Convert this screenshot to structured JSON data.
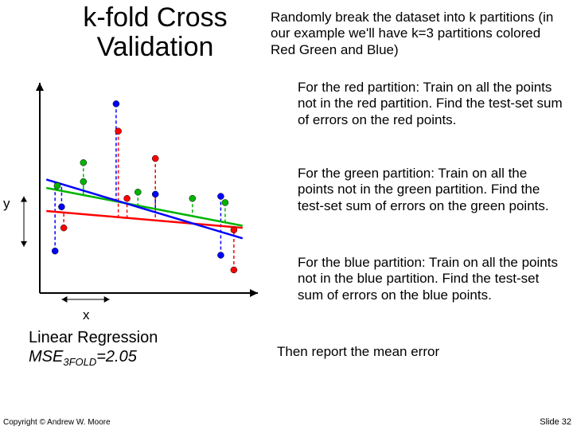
{
  "title": "k-fold Cross Validation",
  "intro": "Randomly break the dataset into k partitions (in our example we'll have k=3 partitions colored Red Green and Blue)",
  "paragraphs": {
    "red": "For the red partition: Train on all the points not in the red partition. Find the test-set sum of errors on the red points.",
    "green": "For the green partition: Train on all the points not in the green partition. Find the test-set sum of errors on the green points.",
    "blue": "For the blue partition: Train on all the points not in the blue partition. Find the test-set sum of errors on the blue points.",
    "mean": "Then report the mean error"
  },
  "axis": {
    "x": "x",
    "y": "y"
  },
  "caption": {
    "line1": "Linear Regression",
    "line2_prefix": "MSE",
    "line2_sub": "3FOLD",
    "line2_eq": "=2.05"
  },
  "footer": {
    "copyright": "Copyright © Andrew W. Moore",
    "slide": "Slide 32"
  },
  "colors": {
    "red": "#ff0000",
    "green": "#00b400",
    "blue": "#0000ff",
    "axis": "#000"
  },
  "chart_data": {
    "type": "scatter",
    "title": "k-fold Cross Validation",
    "xlabel": "x",
    "ylabel": "y",
    "xlim": [
      0,
      10
    ],
    "ylim": [
      0,
      10
    ],
    "series": [
      {
        "name": "red",
        "color": "#ff0000",
        "points": [
          [
            1.1,
            3.1
          ],
          [
            3.6,
            7.7
          ],
          [
            5.3,
            6.4
          ],
          [
            4.0,
            4.5
          ],
          [
            8.9,
            3.0
          ],
          [
            8.9,
            1.1
          ]
        ]
      },
      {
        "name": "green",
        "color": "#00b400",
        "points": [
          [
            0.8,
            5.1
          ],
          [
            2.0,
            5.3
          ],
          [
            2.0,
            6.2
          ],
          [
            4.5,
            4.8
          ],
          [
            7.0,
            4.5
          ],
          [
            8.5,
            4.3
          ]
        ]
      },
      {
        "name": "blue",
        "color": "#0000ff",
        "points": [
          [
            0.7,
            2.0
          ],
          [
            1.0,
            4.1
          ],
          [
            3.5,
            9.0
          ],
          [
            5.3,
            4.7
          ],
          [
            8.3,
            4.6
          ],
          [
            8.3,
            1.8
          ]
        ]
      }
    ],
    "lines": [
      {
        "name": "fit-on-not-red",
        "color": "#ff0000",
        "p1": [
          0.3,
          3.9
        ],
        "p2": [
          9.3,
          3.1
        ]
      },
      {
        "name": "fit-on-not-green",
        "color": "#00b400",
        "p1": [
          0.3,
          5.0
        ],
        "p2": [
          9.3,
          3.2
        ]
      },
      {
        "name": "fit-on-not-blue",
        "color": "#0000ff",
        "p1": [
          0.3,
          5.4
        ],
        "p2": [
          9.3,
          2.6
        ]
      }
    ],
    "residuals": "dashed from each point vertically to its same-color regression line"
  }
}
